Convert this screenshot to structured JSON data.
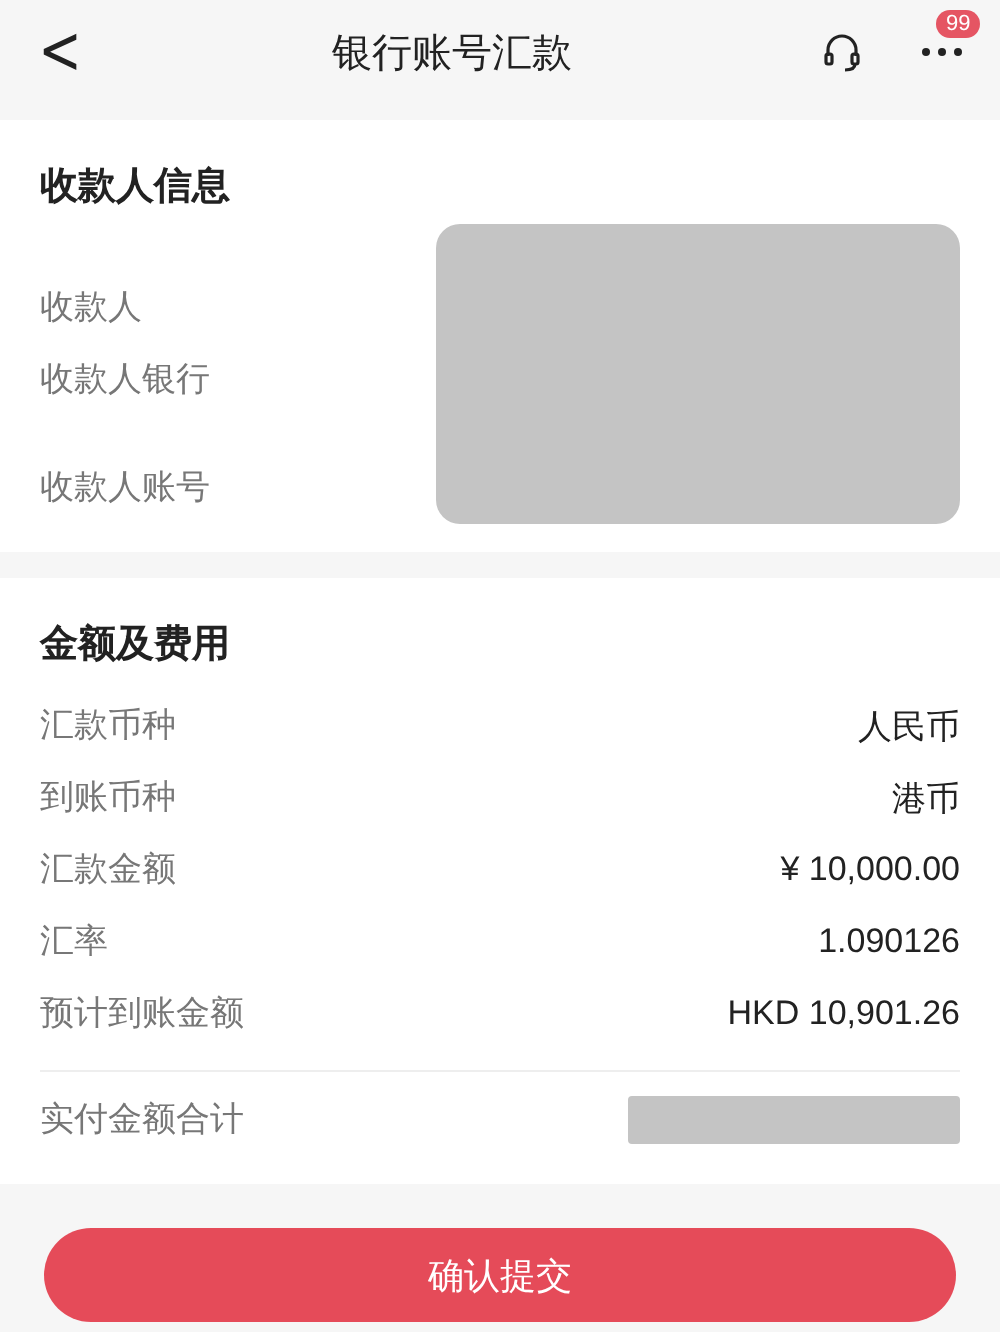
{
  "header": {
    "back": "<",
    "title": "银行账号汇款",
    "badge": "99"
  },
  "payee": {
    "heading": "收款人信息",
    "labels": [
      "收款人",
      "收款人银行",
      "收款人账号"
    ]
  },
  "amounts": {
    "heading": "金额及费用",
    "rows": [
      {
        "label": "汇款币种",
        "value": "人民币"
      },
      {
        "label": "到账币种",
        "value": "港币"
      },
      {
        "label": "汇款金额",
        "value": "¥ 10,000.00"
      },
      {
        "label": "汇率",
        "value": "1.090126"
      },
      {
        "label": "预计到账金额",
        "value": "HKD 10,901.26"
      }
    ],
    "total_label": "实付金额合计"
  },
  "submit": "确认提交"
}
